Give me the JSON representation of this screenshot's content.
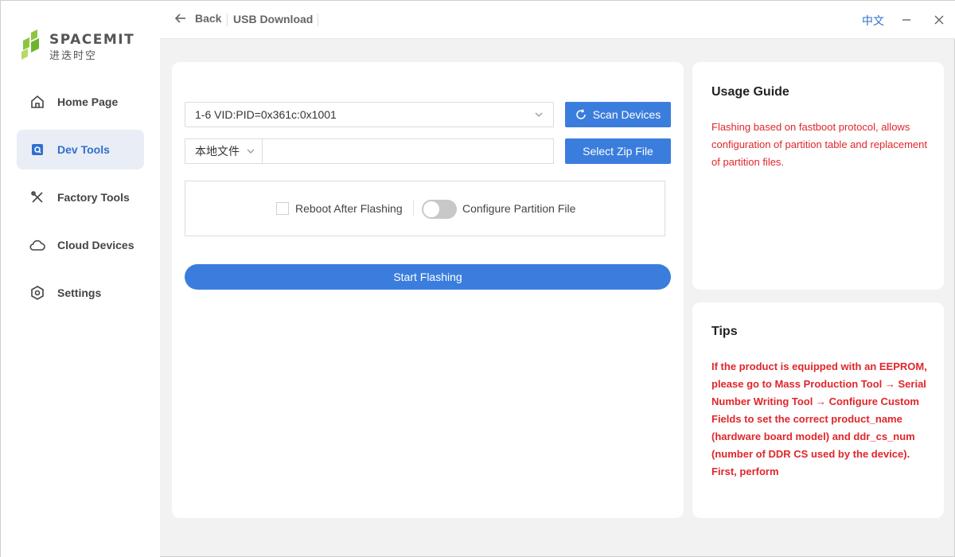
{
  "app": {
    "logo_text": "SPACEMIT",
    "logo_subtext": "进迭时空",
    "colors": {
      "accent": "#3b7ddd",
      "warning_text": "#e0262b",
      "logo_green": "#8cc63f"
    }
  },
  "header": {
    "back_label": "Back",
    "title": "USB Download",
    "language": "中文",
    "icons": [
      "arrow-left-icon",
      "minimize-icon",
      "close-icon"
    ]
  },
  "sidebar": {
    "items": [
      {
        "label": "Home Page",
        "icon": "home-icon",
        "active": false
      },
      {
        "label": "Dev Tools",
        "icon": "dev-tools-icon",
        "active": true
      },
      {
        "label": "Factory Tools",
        "icon": "tools-icon",
        "active": false
      },
      {
        "label": "Cloud Devices",
        "icon": "cloud-icon",
        "active": false
      },
      {
        "label": "Settings",
        "icon": "settings-icon",
        "active": false
      }
    ]
  },
  "main": {
    "device_select_value": "1-6 VID:PID=0x361c:0x1001",
    "scan_button": "Scan Devices",
    "source_select_value": "本地文件",
    "file_path_value": "",
    "select_zip_button": "Select Zip File",
    "reboot_checkbox_label": "Reboot After Flashing",
    "reboot_checked": false,
    "configure_partition_label": "Configure Partition File",
    "configure_partition_on": false,
    "start_button": "Start Flashing"
  },
  "guide": {
    "title": "Usage Guide",
    "text": "Flashing based on fastboot protocol, allows configuration of partition table and replacement of partition files."
  },
  "tips": {
    "title": "Tips",
    "text": "If the product is equipped with an EEPROM, please go to Mass Production Tool → Serial Number Writing Tool → Configure Custom Fields to set the correct product_name (hardware board model) and ddr_cs_num (number of DDR CS used by the device). First, perform"
  }
}
